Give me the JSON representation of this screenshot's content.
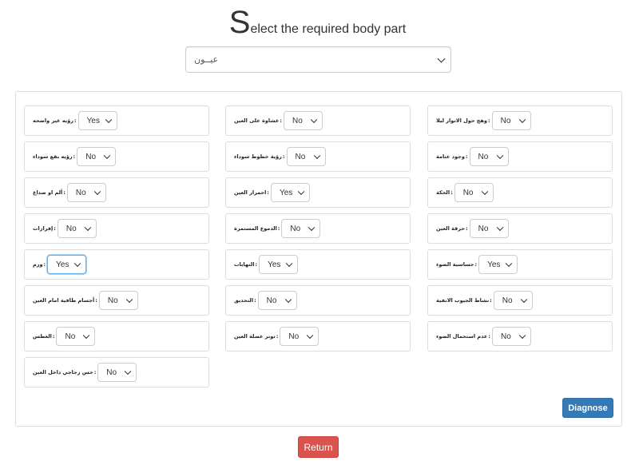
{
  "page": {
    "title_initial": "S",
    "title_rest": "elect the required body part"
  },
  "body_part_select": {
    "value": "عيــون"
  },
  "symptoms": [
    {
      "label": "رؤيه غير واضحه",
      "value": "Yes"
    },
    {
      "label": "غشاوة على العين",
      "value": "No"
    },
    {
      "label": "وهج حول الانوار ليلا",
      "value": "No"
    },
    {
      "label": "رؤيه بقع سوداء",
      "value": "No"
    },
    {
      "label": "رؤية خطوط سوداء",
      "value": "No"
    },
    {
      "label": "وجود عتامة",
      "value": "No"
    },
    {
      "label": "ألم او صداع",
      "value": "No"
    },
    {
      "label": "احمرار العين",
      "value": "Yes"
    },
    {
      "label": "الحكة",
      "value": "No"
    },
    {
      "label": "إفرازات",
      "value": "No"
    },
    {
      "label": "الدموع المستمرة",
      "value": "No"
    },
    {
      "label": "حرقة العين",
      "value": "No"
    },
    {
      "label": "ورم",
      "value": "Yes"
    },
    {
      "label": "التهابات",
      "value": "Yes"
    },
    {
      "label": "حساسية الضوء",
      "value": "Yes"
    },
    {
      "label": "أجسام طافية امام العين",
      "value": "No"
    },
    {
      "label": "التحديق",
      "value": "No"
    },
    {
      "label": "نشاط الجيوب الانفية",
      "value": "No"
    },
    {
      "label": "العطس",
      "value": "No"
    },
    {
      "label": "توتر عضلة العين",
      "value": "No"
    },
    {
      "label": "عدم استحمال الضوء",
      "value": "No"
    },
    {
      "label": "خس زجاجي داخل العين",
      "value": "No"
    }
  ],
  "buttons": {
    "diagnose": "Diagnose",
    "return": "Return"
  }
}
